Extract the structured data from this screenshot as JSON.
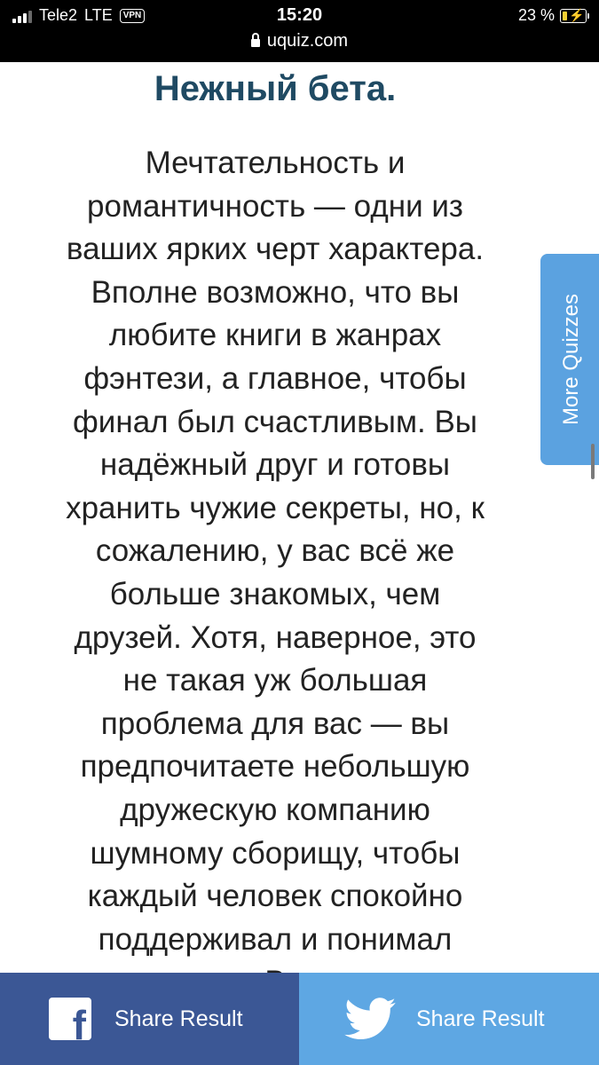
{
  "status_bar": {
    "carrier": "Tele2",
    "network": "LTE",
    "vpn": "VPN",
    "time": "15:20",
    "url": "uquiz.com",
    "battery_text": "23 %",
    "battery_level": 0.23
  },
  "result": {
    "title": "Нежный бета.",
    "lines": [
      "Мечтательность и",
      "романтичность — одни из",
      "ваших ярких черт характера.",
      "Вполне возможно, что вы",
      "любите книги в жанрах",
      "фэнтези, а главное, чтобы",
      "финал был счастливым. Вы",
      "надёжный друг и готовы",
      "хранить чужие секреты, но, к",
      "сожалению, у вас всё же",
      "больше знакомых, чем",
      "друзей. Хотя, наверное, это",
      "не такая уж большая",
      "проблема для вас — вы",
      "предпочитаете небольшую",
      "дружескую компанию",
      "шумному сборищу, чтобы",
      "каждый человек спокойно",
      "поддерживал и понимал",
      "В"
    ]
  },
  "sidebar_tab": {
    "label": "More Quizzes"
  },
  "share": {
    "facebook_label": "Share Result",
    "twitter_label": "Share Result"
  },
  "colors": {
    "title": "#1f4a63",
    "facebook": "#3b5795",
    "twitter": "#5ea7e3",
    "more_tab": "#5ba2e0"
  }
}
